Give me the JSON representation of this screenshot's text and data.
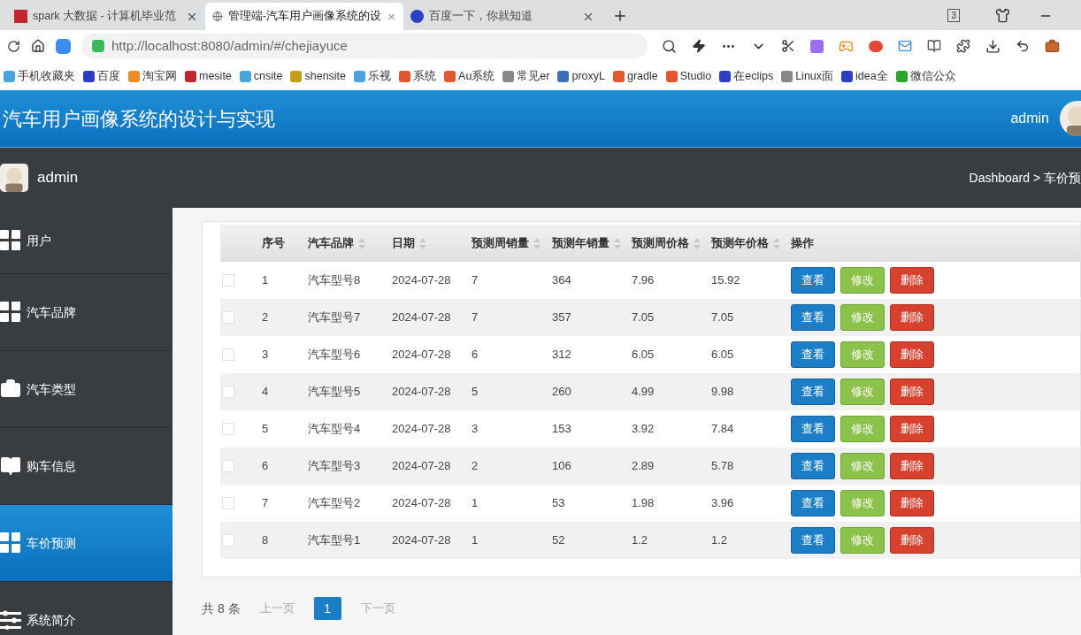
{
  "browser": {
    "tabs": [
      {
        "title": "spark 大数据 - 计算机毕业范",
        "selected": false
      },
      {
        "title": "管理端-汽车用户画像系统的设",
        "selected": true
      },
      {
        "title": "百度一下，你就知道",
        "selected": false
      }
    ],
    "tab_count": "3",
    "url": "http://localhost:8080/admin/#/chejiayuce",
    "bookmarks": [
      "手机收藏夹",
      "百度",
      "淘宝网",
      "mesite",
      "cnsite",
      "shensite",
      "乐视",
      "系统",
      "Au系统",
      "常见er",
      "proxyL",
      "gradle",
      "Studio",
      "在eclips",
      "Linux面",
      "idea全",
      "微信公众"
    ]
  },
  "header": {
    "title": "汽车用户画像系统的设计与实现",
    "user": "admin"
  },
  "subheader": {
    "user": "admin",
    "breadcrumb": "Dashboard > 车价预"
  },
  "sidebar": {
    "items": [
      {
        "label": "用户",
        "kind": "grid",
        "selected": false
      },
      {
        "label": "汽车品牌",
        "kind": "grid",
        "selected": false
      },
      {
        "label": "汽车类型",
        "kind": "briefcase",
        "selected": false
      },
      {
        "label": "购车信息",
        "kind": "book",
        "selected": false
      },
      {
        "label": "车价预测",
        "kind": "grid",
        "selected": true
      },
      {
        "label": "系统简介",
        "kind": "sliders",
        "selected": false
      }
    ]
  },
  "table": {
    "columns": [
      {
        "label": "序号",
        "sortable": false
      },
      {
        "label": "汽车品牌",
        "sortable": true
      },
      {
        "label": "日期",
        "sortable": true
      },
      {
        "label": "预测周销量",
        "sortable": true
      },
      {
        "label": "预测年销量",
        "sortable": true
      },
      {
        "label": "预测周价格",
        "sortable": true
      },
      {
        "label": "预测年价格",
        "sortable": true
      },
      {
        "label": "操作",
        "sortable": false
      }
    ],
    "rows": [
      {
        "checked": false,
        "cells": [
          "1",
          "汽车型号8",
          "2024-07-28",
          "7",
          "364",
          "7.96",
          "15.92"
        ],
        "actions": [
          "查看",
          "修改",
          "删除"
        ]
      },
      {
        "checked": false,
        "cells": [
          "2",
          "汽车型号7",
          "2024-07-28",
          "7",
          "357",
          "7.05",
          "7.05"
        ],
        "actions": [
          "查看",
          "修改",
          "删除"
        ]
      },
      {
        "checked": false,
        "cells": [
          "3",
          "汽车型号6",
          "2024-07-28",
          "6",
          "312",
          "6.05",
          "6.05"
        ],
        "actions": [
          "查看",
          "修改",
          "删除"
        ]
      },
      {
        "checked": false,
        "cells": [
          "4",
          "汽车型号5",
          "2024-07-28",
          "5",
          "260",
          "4.99",
          "9.98"
        ],
        "actions": [
          "查看",
          "修改",
          "删除"
        ]
      },
      {
        "checked": false,
        "cells": [
          "5",
          "汽车型号4",
          "2024-07-28",
          "3",
          "153",
          "3.92",
          "7.84"
        ],
        "actions": [
          "查看",
          "修改",
          "删除"
        ]
      },
      {
        "checked": false,
        "cells": [
          "6",
          "汽车型号3",
          "2024-07-28",
          "2",
          "106",
          "2.89",
          "5.78"
        ],
        "actions": [
          "查看",
          "修改",
          "删除"
        ]
      },
      {
        "checked": false,
        "cells": [
          "7",
          "汽车型号2",
          "2024-07-28",
          "1",
          "53",
          "1.98",
          "3.96"
        ],
        "actions": [
          "查看",
          "修改",
          "删除"
        ]
      },
      {
        "checked": false,
        "cells": [
          "8",
          "汽车型号1",
          "2024-07-28",
          "1",
          "52",
          "1.2",
          "1.2"
        ],
        "actions": [
          "查看",
          "修改",
          "删除"
        ]
      }
    ]
  },
  "pagination": {
    "total": "共 8 条",
    "prev": "上一页",
    "pages": [
      {
        "label": "1",
        "selected": true
      }
    ],
    "next": "下一页"
  }
}
